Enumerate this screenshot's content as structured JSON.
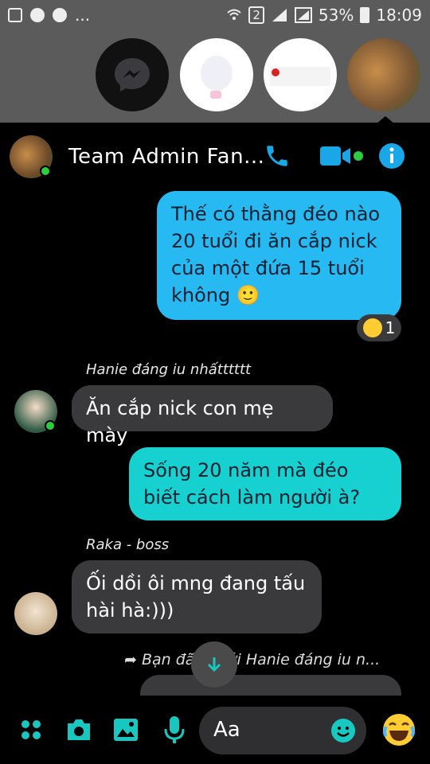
{
  "status_bar": {
    "dots": "...",
    "sim_badge": "2",
    "battery": "53%",
    "time": "18:09"
  },
  "chat_heads": [
    {
      "name": "messenger",
      "icon": "messenger-icon"
    },
    {
      "name": "contact-2"
    },
    {
      "name": "contact-3"
    },
    {
      "name": "contact-4-active"
    }
  ],
  "header": {
    "title": "Team Admin Fan...",
    "call_icon": "phone-icon",
    "video_icon": "video-icon",
    "info_icon": "info-icon"
  },
  "messages": [
    {
      "type": "outgoing",
      "text": "Thế có thằng đéo nào 20 tuổi đi ăn cắp nick của một đứa 15 tuổi không 🙂",
      "reaction": {
        "emoji": "laugh",
        "count": "1"
      }
    },
    {
      "type": "incoming",
      "sender": "Hanie đáng iu nhấtttttt",
      "text": "Ăn cắp nick con mẹ mày"
    },
    {
      "type": "outgoing",
      "text": "Sống 20 năm mà đéo biết cách làm người à?"
    },
    {
      "type": "incoming",
      "sender": "Raka - boss",
      "text": "Ối dồi ôi mng đang tấu hài hà:)))"
    },
    {
      "type": "forward",
      "text": "Bạn đã ... với Hanie đáng iu n..."
    }
  ],
  "composer": {
    "placeholder": "Aa",
    "icons": [
      "apps-icon",
      "camera-icon",
      "gallery-icon",
      "mic-icon",
      "emoji-icon",
      "laugh-emoji-icon"
    ]
  },
  "colors": {
    "outgoing_bubble": "#26b9f2",
    "outgoing_bubble_2": "#17d0d0",
    "incoming_bubble": "#3a3a3c",
    "accent": "#1aa7e8",
    "composer_icon": "#18c8c0"
  }
}
